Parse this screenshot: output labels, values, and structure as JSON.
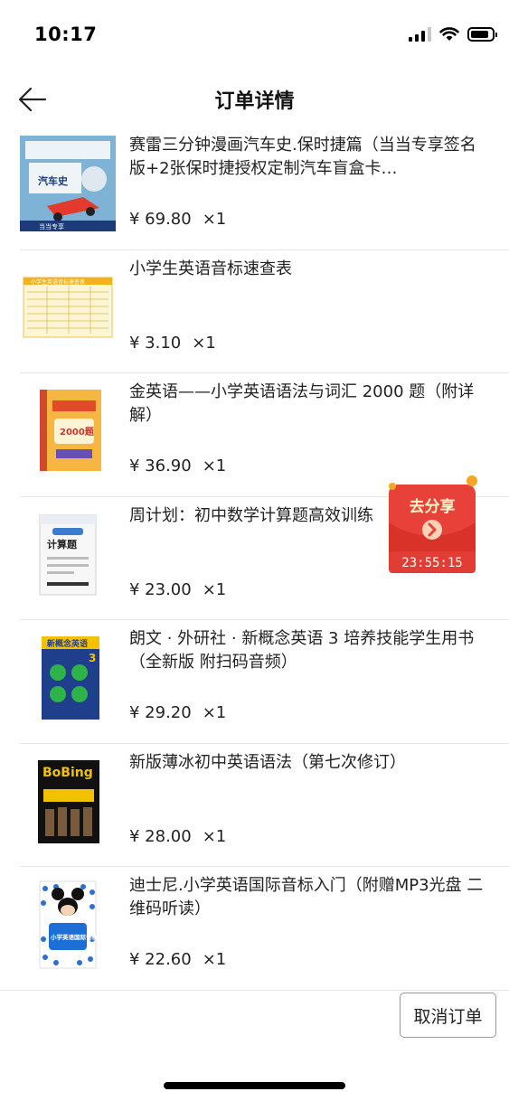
{
  "status_bar": {
    "time": "10:17",
    "battery_level": 0.7
  },
  "nav": {
    "title": "订单详情",
    "back_icon": "arrow-left-icon"
  },
  "items": [
    {
      "title": "赛雷三分钟漫画汽车史.保时捷篇（当当专享签名版+2张保时捷授权定制汽车盲盒卡…",
      "price": "¥ 69.80",
      "qty": "×1",
      "thumb_text": "汽车史",
      "thumb_banner": "当当专享"
    },
    {
      "title": "小学生英语音标速查表",
      "price": "¥ 3.10",
      "qty": "×1",
      "thumb_text": "小学生英语音标速查表"
    },
    {
      "title": "金英语——小学英语语法与词汇 2000 题（附详解）",
      "price": "¥ 36.90",
      "qty": "×1",
      "thumb_text": "2000题"
    },
    {
      "title": "周计划：初中数学计算题高效训练",
      "price": "¥ 23.00",
      "qty": "×1",
      "thumb_text": "计算题"
    },
    {
      "title": "朗文 · 外研社 · 新概念英语 3 培养技能学生用书（全新版 附扫码音频）",
      "price": "¥ 29.20",
      "qty": "×1",
      "thumb_text": "新概念英语"
    },
    {
      "title": "新版薄冰初中英语语法（第七次修订）",
      "price": "¥ 28.00",
      "qty": "×1",
      "thumb_text": "BoBing"
    },
    {
      "title": "迪士尼.小学英语国际音标入门（附赠MP3光盘 二维码听读）",
      "price": "¥ 22.60",
      "qty": "×1",
      "thumb_text": "小学英语国际音标入门"
    }
  ],
  "share_widget": {
    "label": "去分享",
    "countdown": "23:55:15"
  },
  "actions": {
    "cancel_label": "取消订单"
  },
  "colors": {
    "share_red": "#e8413a",
    "text": "#222222",
    "divider": "#e6e6e6"
  }
}
